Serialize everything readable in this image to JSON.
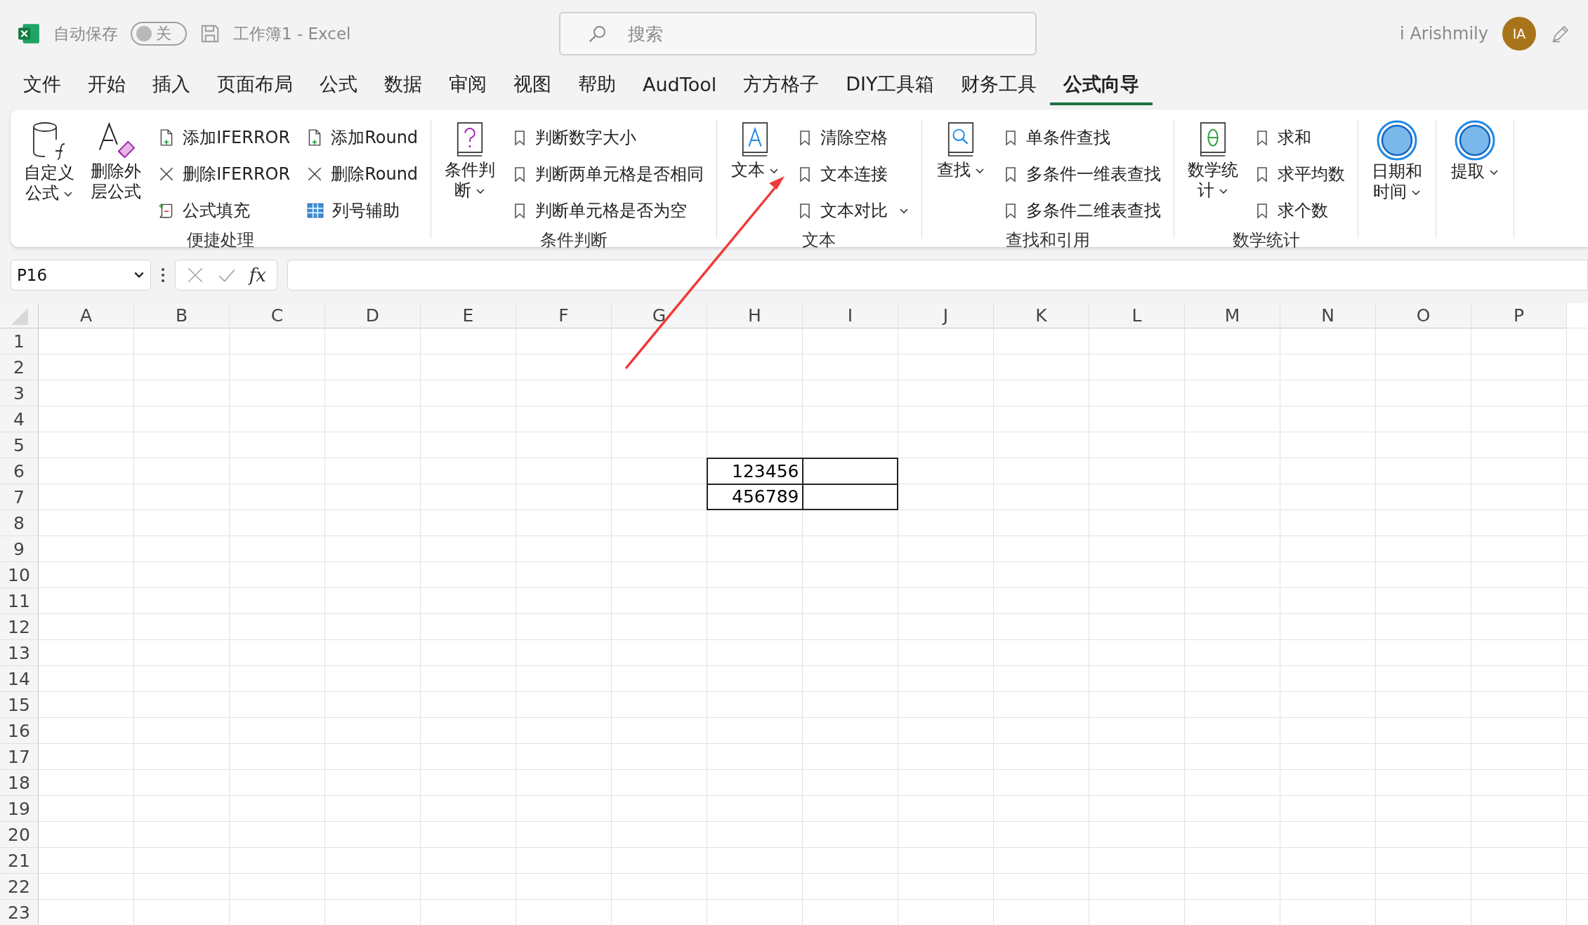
{
  "title_bar": {
    "autosave_label": "自动保存",
    "autosave": {
      "on": false,
      "label": "关"
    },
    "document_title": "工作簿1  -  Excel",
    "search": {
      "placeholder": "搜索"
    },
    "user_name": "i Arishmily",
    "avatar": "IA"
  },
  "tabs": [
    {
      "label": "文件",
      "selected": false
    },
    {
      "label": "开始",
      "selected": false
    },
    {
      "label": "插入",
      "selected": false
    },
    {
      "label": "页面布局",
      "selected": false
    },
    {
      "label": "公式",
      "selected": false
    },
    {
      "label": "数据",
      "selected": false
    },
    {
      "label": "审阅",
      "selected": false
    },
    {
      "label": "视图",
      "selected": false
    },
    {
      "label": "帮助",
      "selected": false
    },
    {
      "label": "AudTool",
      "selected": false
    },
    {
      "label": "方方格子",
      "selected": false
    },
    {
      "label": "DIY工具箱",
      "selected": false
    },
    {
      "label": "财务工具",
      "selected": false
    },
    {
      "label": "公式向导",
      "selected": true
    }
  ],
  "ribbon": {
    "groups": [
      {
        "label": "便捷处理",
        "buttons": [
          {
            "label": "自定义公式",
            "dropdown": true
          },
          {
            "label": "删除外层公式",
            "dropdown": false
          }
        ],
        "commands": [
          {
            "label": "添加IFERROR",
            "dropdown": false
          },
          {
            "label": "删除IFERROR",
            "dropdown": false
          },
          {
            "label": "公式填充",
            "dropdown": false
          },
          {
            "label": "添加Round",
            "dropdown": false
          },
          {
            "label": "删除Round",
            "dropdown": false
          },
          {
            "label": "列号辅助",
            "dropdown": false
          }
        ]
      },
      {
        "label": "条件判断",
        "buttons": [
          {
            "label": "条件判断",
            "dropdown": true
          }
        ],
        "commands": [
          {
            "label": "判断数字大小",
            "dropdown": false
          },
          {
            "label": "判断两单元格是否相同",
            "dropdown": false
          },
          {
            "label": "判断单元格是否为空",
            "dropdown": false
          }
        ]
      },
      {
        "label": "文本",
        "buttons": [
          {
            "label": "文本",
            "dropdown": true
          }
        ],
        "commands": [
          {
            "label": "清除空格",
            "dropdown": false
          },
          {
            "label": "文本连接",
            "dropdown": false
          },
          {
            "label": "文本对比",
            "dropdown": true
          }
        ]
      },
      {
        "label": "查找和引用",
        "buttons": [
          {
            "label": "查找",
            "dropdown": true
          }
        ],
        "commands": [
          {
            "label": "单条件查找",
            "dropdown": false
          },
          {
            "label": "多条件一维表查找",
            "dropdown": false
          },
          {
            "label": "多条件二维表查找",
            "dropdown": false
          }
        ]
      },
      {
        "label": "数学统计",
        "buttons": [
          {
            "label": "数学统计",
            "dropdown": true
          }
        ],
        "commands": [
          {
            "label": "求和",
            "dropdown": false
          },
          {
            "label": "求平均数",
            "dropdown": false
          },
          {
            "label": "求个数",
            "dropdown": false
          }
        ]
      },
      {
        "buttons": [
          {
            "label": "日期和时间",
            "dropdown": true
          }
        ]
      },
      {
        "buttons": [
          {
            "label": "提取",
            "dropdown": true
          }
        ]
      }
    ]
  },
  "formula_bar": {
    "name_box": "P16",
    "function_button": "fx"
  },
  "sheet": {
    "columns": [
      "A",
      "B",
      "C",
      "D",
      "E",
      "F",
      "G",
      "H",
      "I",
      "J",
      "K",
      "L",
      "M",
      "N",
      "O",
      "P"
    ],
    "rows": [
      "1",
      "2",
      "3",
      "4",
      "5",
      "6",
      "7",
      "8",
      "9",
      "10",
      "11",
      "12",
      "13",
      "14",
      "15",
      "16",
      "17",
      "18",
      "19",
      "20",
      "21",
      "22",
      "23"
    ],
    "data_block": {
      "bordered": true,
      "rows": [
        [
          "123456",
          null
        ],
        [
          "456789",
          null
        ]
      ]
    }
  },
  "annotation_arrow": true
}
